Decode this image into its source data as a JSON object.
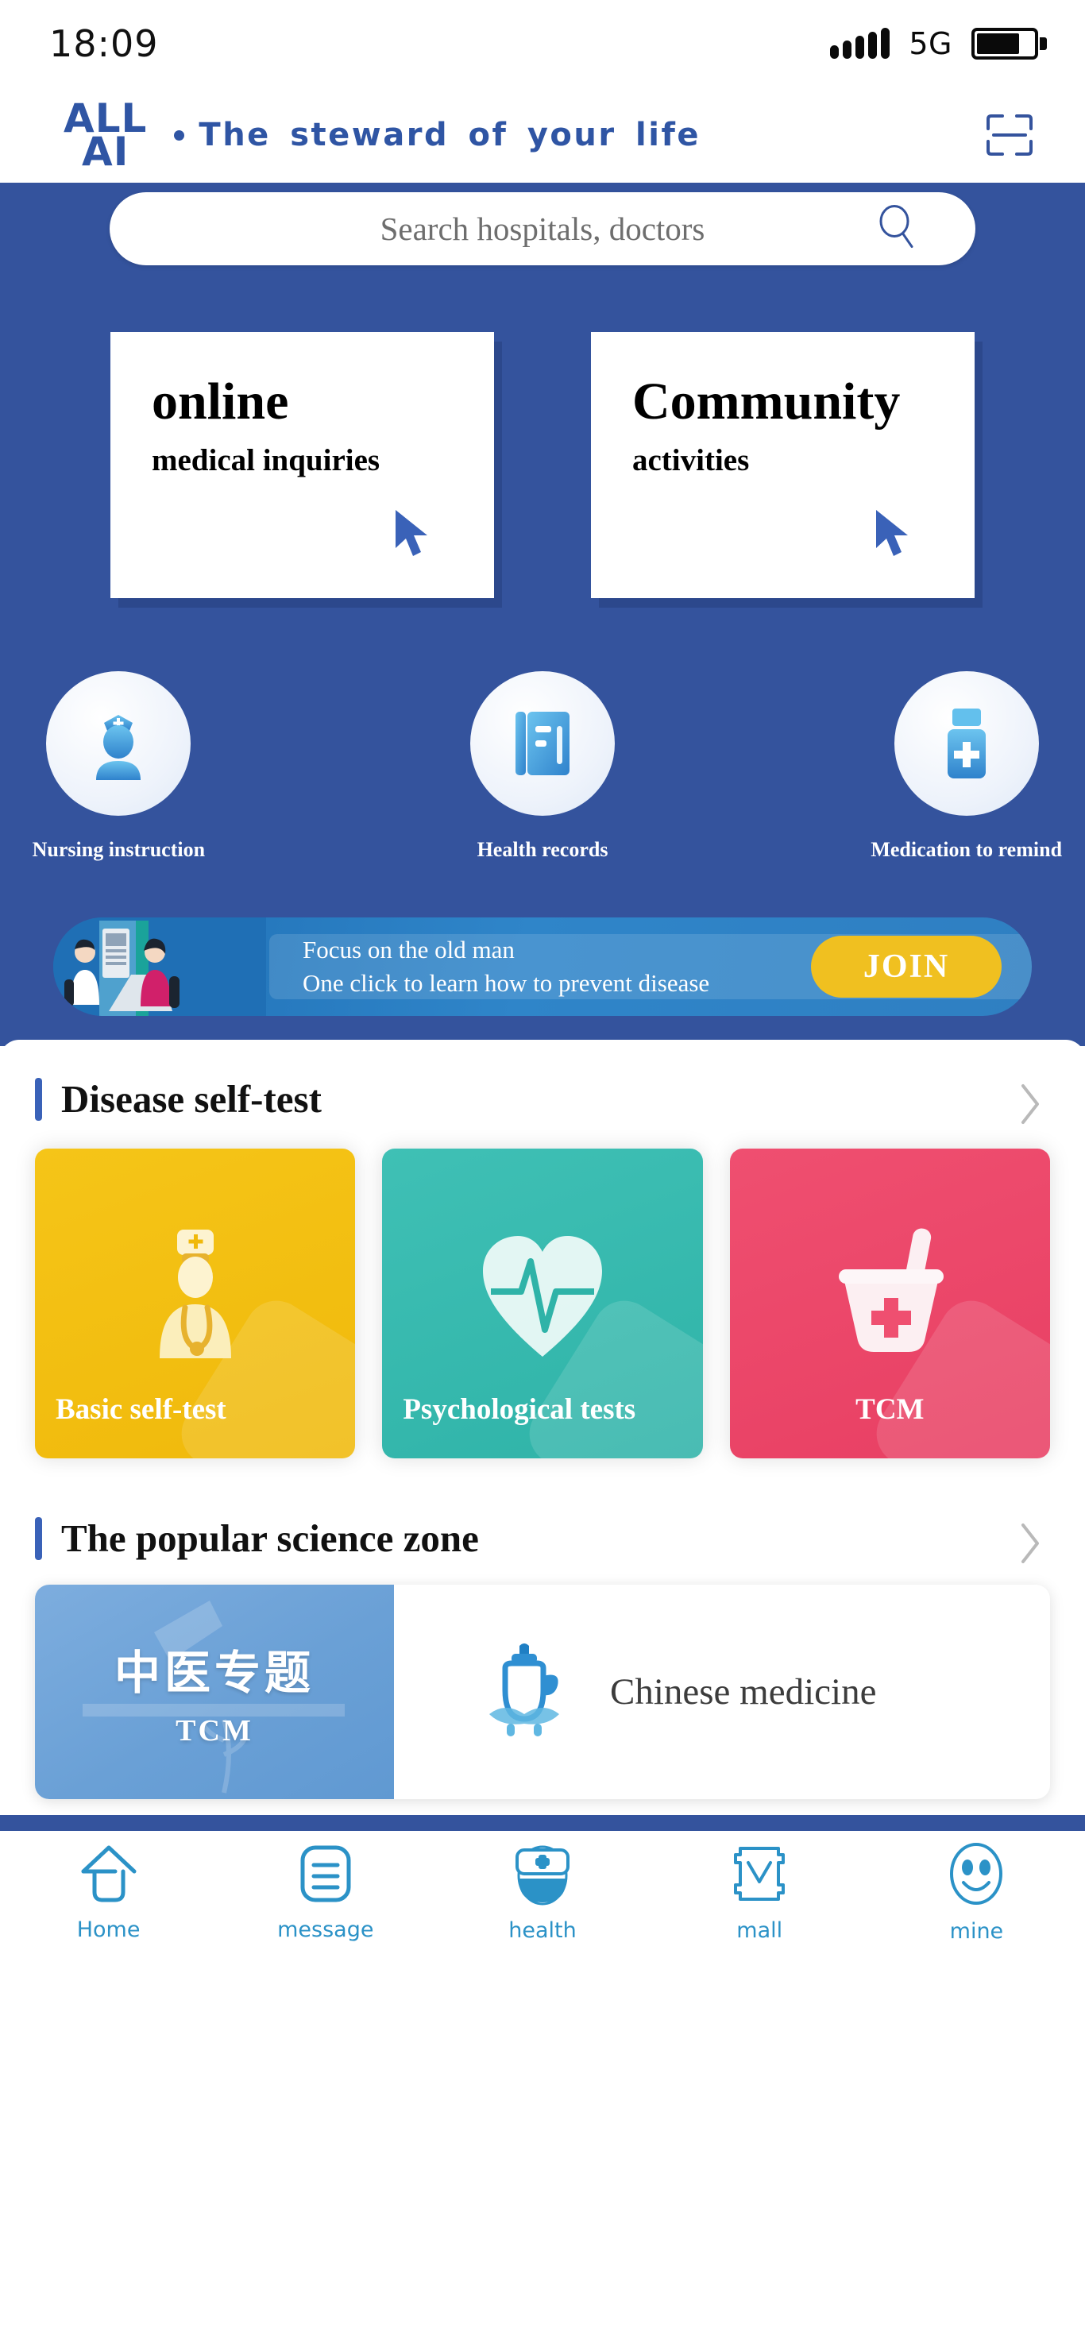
{
  "status_bar": {
    "time": "18:09",
    "network": "5G",
    "signal_icon": "signal-bars-icon",
    "battery_icon": "battery-icon",
    "battery_level": 75
  },
  "header": {
    "logo_line1": "ALL",
    "logo_line2": "AI",
    "tagline": "The steward of your life",
    "scan_icon": "scan-qr-icon",
    "brand_color": "#2f55a4"
  },
  "search": {
    "placeholder": "Search hospitals, doctors",
    "value": "",
    "icon": "search-icon"
  },
  "hero": {
    "background_color": "#34539d",
    "cards": [
      {
        "title": "online",
        "subtitle": "medical inquiries",
        "icon": "cursor-arrow-icon"
      },
      {
        "title": "Community",
        "subtitle": "activities",
        "icon": "cursor-arrow-icon"
      }
    ],
    "features": [
      {
        "label": "Nursing instruction",
        "icon": "nurse-icon"
      },
      {
        "label": "Health records",
        "icon": "records-book-icon"
      },
      {
        "label": "Medication to remind",
        "icon": "medicine-bottle-icon"
      }
    ],
    "promo": {
      "line1": "Focus on the old man",
      "line2": "One click to learn how to prevent disease",
      "button_label": "JOIN",
      "button_color": "#f0c020",
      "illustration": "doctor-consultation-illustration"
    }
  },
  "sections": [
    {
      "title": "Disease self-test",
      "more_icon": "chevron-right-icon",
      "cards": [
        {
          "label": "Basic self-test",
          "color": "#f0b90b",
          "icon": "doctor-icon"
        },
        {
          "label": "Psychological tests",
          "color": "#2fb3a8",
          "icon": "heart-pulse-icon"
        },
        {
          "label": "TCM",
          "color": "#e83f63",
          "icon": "mortar-pestle-icon"
        }
      ]
    },
    {
      "title": "The popular science zone",
      "more_icon": "chevron-right-icon",
      "card": {
        "badge_cn": "中医专题",
        "badge_en": "TCM",
        "title": "Chinese medicine",
        "icon": "medicine-pot-icon",
        "panel_color": "#6aa0d6"
      }
    }
  ],
  "bottom_nav": {
    "active_index": 0,
    "accent_color": "#2b92c7",
    "items": [
      {
        "label": "Home",
        "icon": "home-icon"
      },
      {
        "label": "message",
        "icon": "message-list-icon"
      },
      {
        "label": "health",
        "icon": "medical-bag-icon"
      },
      {
        "label": "mall",
        "icon": "mall-bag-icon"
      },
      {
        "label": "mine",
        "icon": "smiley-face-icon"
      }
    ]
  }
}
